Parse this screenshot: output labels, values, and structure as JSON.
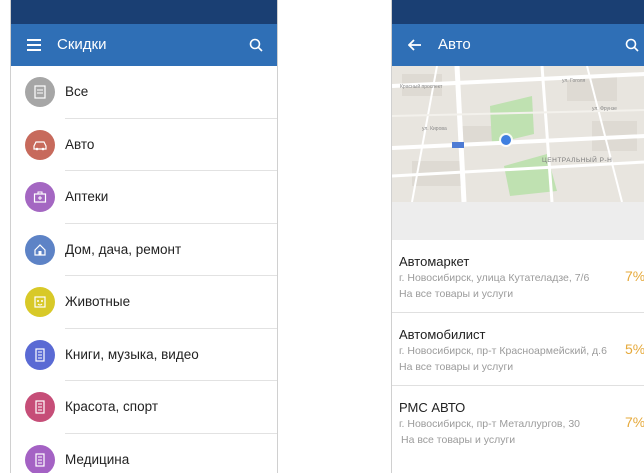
{
  "left": {
    "title": "Скидки",
    "categories": [
      {
        "label": "Все",
        "icon": "list-icon",
        "color": "#a6a6a6"
      },
      {
        "label": "Авто",
        "icon": "car-icon",
        "color": "#c76a5c"
      },
      {
        "label": "Аптеки",
        "icon": "medkit-icon",
        "color": "#a467c2"
      },
      {
        "label": "Дом, дача, ремонт",
        "icon": "house-icon",
        "color": "#5d83c6"
      },
      {
        "label": "Животные",
        "icon": "pet-icon",
        "color": "#d8c928"
      },
      {
        "label": "Книги, музыка, видео",
        "icon": "book-icon",
        "color": "#5a6ad4"
      },
      {
        "label": "Красота, спорт",
        "icon": "beauty-icon",
        "color": "#c64e78"
      },
      {
        "label": "Медицина",
        "icon": "medicine-icon",
        "color": "#a462c4"
      }
    ]
  },
  "right": {
    "title": "Авто",
    "map": {
      "district_label": "ЦЕНТРАЛЬНЫЙ Р-Н",
      "street_label_1": "Красный проспект",
      "street_label_2": "ул. Гоголя",
      "street_label_3": "ул. Фрунзе",
      "street_label_4": "ул. Кирова"
    },
    "shops": [
      {
        "name": "Автомаркет",
        "address": "г. Новосибирск, улица Кутателадзе, 7/6",
        "note": "На все товары и услуги",
        "discount": "7%"
      },
      {
        "name": "Автомобилист",
        "address": "г. Новосибирск, пр-т Красноармейский, д.6",
        "note": "На все товары и услуги",
        "discount": "5%"
      },
      {
        "name": "РМС АВТО",
        "address": "г. Новосибирск, пр-т Металлургов, 30",
        "note": "На все товары и услуги",
        "discount": "7%"
      }
    ]
  },
  "colors": {
    "statusbar": "#1a3f73",
    "appbar": "#2f6fb6",
    "discount": "#e6a93a"
  }
}
